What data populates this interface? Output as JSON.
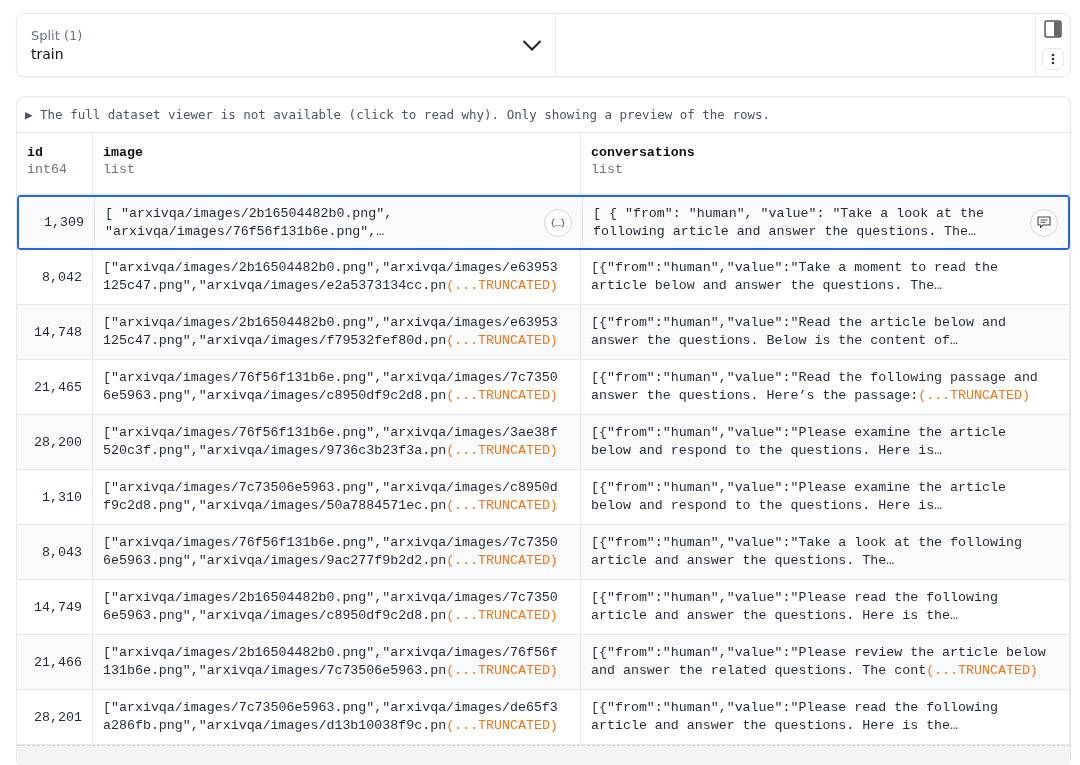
{
  "split_selector": {
    "label": "Split (1)",
    "value": "train"
  },
  "notice": {
    "marker": "▶",
    "text": "The full dataset viewer is not available (click to read why). Only showing a preview of the rows."
  },
  "table": {
    "columns": [
      {
        "name": "id",
        "type": "int64"
      },
      {
        "name": "image",
        "type": "list"
      },
      {
        "name": "conversations",
        "type": "list"
      }
    ],
    "rows": [
      {
        "selected": true,
        "id": "1,309",
        "image": {
          "text": "[ \"arxivqa/images/2b16504482b0.png\",\n\"arxivqa/images/76f56f131b6e.png\",…"
        },
        "conversations": {
          "text": "[ { \"from\": \"human\", \"value\": \"Take a look at the\nfollowing article and answer the questions. The…"
        }
      },
      {
        "selected": false,
        "id": "8,042",
        "image": {
          "text": "[\"arxivqa/images/2b16504482b0.png\",\"arxivqa/images/e63953\n125c47.png\",\"arxivqa/images/e2a5373134cc.pn",
          "truncated_label": "(...TRUNCATED)"
        },
        "conversations": {
          "text": "[{\"from\":\"human\",\"value\":\"Take a moment to read the\narticle below and answer the questions. The…"
        }
      },
      {
        "selected": false,
        "id": "14,748",
        "image": {
          "text": "[\"arxivqa/images/2b16504482b0.png\",\"arxivqa/images/e63953\n125c47.png\",\"arxivqa/images/f79532fef80d.pn",
          "truncated_label": "(...TRUNCATED)"
        },
        "conversations": {
          "text": "[{\"from\":\"human\",\"value\":\"Read the article below and\nanswer the questions. Below is the content of…"
        }
      },
      {
        "selected": false,
        "id": "21,465",
        "image": {
          "text": "[\"arxivqa/images/76f56f131b6e.png\",\"arxivqa/images/7c7350\n6e5963.png\",\"arxivqa/images/c8950df9c2d8.pn",
          "truncated_label": "(...TRUNCATED)"
        },
        "conversations": {
          "text": "[{\"from\":\"human\",\"value\":\"Read the following passage and\nanswer the questions. Here’s the passage:",
          "truncated_label": "(...TRUNCATED)"
        }
      },
      {
        "selected": false,
        "id": "28,200",
        "image": {
          "text": "[\"arxivqa/images/76f56f131b6e.png\",\"arxivqa/images/3ae38f\n520c3f.png\",\"arxivqa/images/9736c3b23f3a.pn",
          "truncated_label": "(...TRUNCATED)"
        },
        "conversations": {
          "text": "[{\"from\":\"human\",\"value\":\"Please examine the article\nbelow and respond to the questions. Here is…"
        }
      },
      {
        "selected": false,
        "id": "1,310",
        "image": {
          "text": "[\"arxivqa/images/7c73506e5963.png\",\"arxivqa/images/c8950d\nf9c2d8.png\",\"arxivqa/images/50a7884571ec.pn",
          "truncated_label": "(...TRUNCATED)"
        },
        "conversations": {
          "text": "[{\"from\":\"human\",\"value\":\"Please examine the article\nbelow and respond to the questions. Here is…"
        }
      },
      {
        "selected": false,
        "id": "8,043",
        "image": {
          "text": "[\"arxivqa/images/76f56f131b6e.png\",\"arxivqa/images/7c7350\n6e5963.png\",\"arxivqa/images/9ac277f9b2d2.pn",
          "truncated_label": "(...TRUNCATED)"
        },
        "conversations": {
          "text": "[{\"from\":\"human\",\"value\":\"Take a look at the following\narticle and answer the questions. The…"
        }
      },
      {
        "selected": false,
        "id": "14,749",
        "image": {
          "text": "[\"arxivqa/images/2b16504482b0.png\",\"arxivqa/images/7c7350\n6e5963.png\",\"arxivqa/images/c8950df9c2d8.pn",
          "truncated_label": "(...TRUNCATED)"
        },
        "conversations": {
          "text": "[{\"from\":\"human\",\"value\":\"Please read the following\narticle and answer the questions. Here is the…"
        }
      },
      {
        "selected": false,
        "id": "21,466",
        "image": {
          "text": "[\"arxivqa/images/2b16504482b0.png\",\"arxivqa/images/76f56f\n131b6e.png\",\"arxivqa/images/7c73506e5963.pn",
          "truncated_label": "(...TRUNCATED)"
        },
        "conversations": {
          "text": "[{\"from\":\"human\",\"value\":\"Please review the article below\nand answer the related questions. The cont",
          "truncated_label": "(...TRUNCATED)"
        }
      },
      {
        "selected": false,
        "id": "28,201",
        "image": {
          "text": "[\"arxivqa/images/7c73506e5963.png\",\"arxivqa/images/de65f3\na286fb.png\",\"arxivqa/images/d13b10038f9c.pn",
          "truncated_label": "(...TRUNCATED)"
        },
        "conversations": {
          "text": "[{\"from\":\"human\",\"value\":\"Please read the following\narticle and answer the questions. Here is the…"
        }
      }
    ]
  }
}
